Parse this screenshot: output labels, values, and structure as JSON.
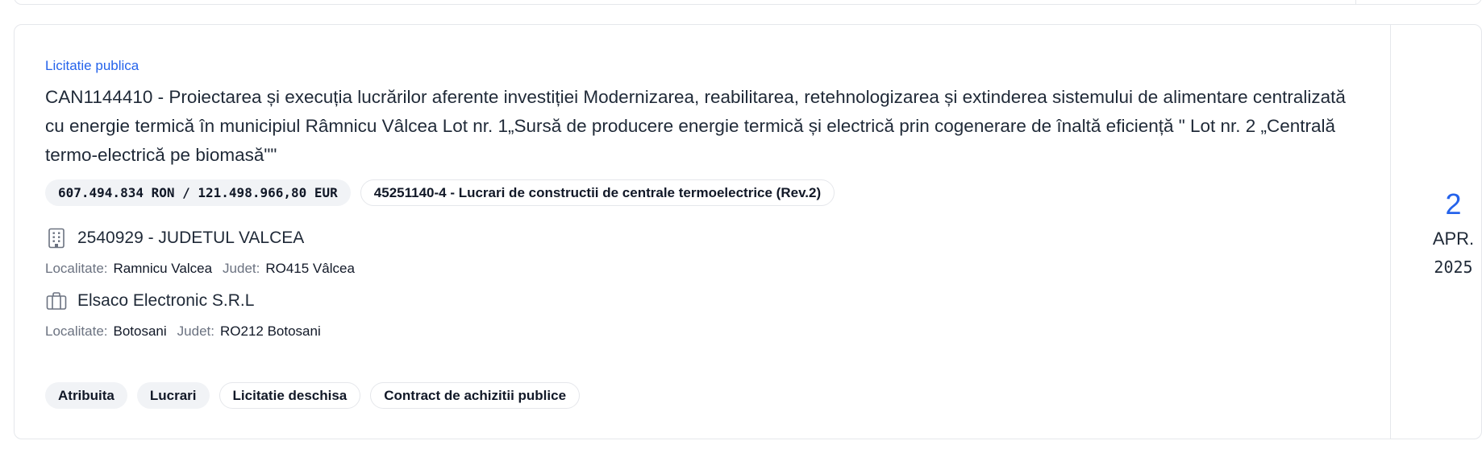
{
  "card": {
    "type_label": "Licitatie publica",
    "title": "CAN1144410 - Proiectarea și execuția lucrărilor aferente investiției Modernizarea, reabilitarea, retehnologizarea și extinderea sistemului de alimentare centralizată cu energie termică în municipiul Râmnicu Vâlcea Lot nr. 1„Sursă de producere energie termică și electrică prin cogenerare de înaltă eficiență \" Lot nr. 2 „Centrală termo-electrică pe biomasă\"\"",
    "value_pill": "607.494.834 RON / 121.498.966,80 EUR",
    "cpv_pill": "45251140-4 - Lucrari de constructii de centrale termoelectrice (Rev.2)",
    "authority": {
      "name": "2540929 - JUDETUL VALCEA",
      "localitate_label": "Localitate:",
      "localitate": "Ramnicu Valcea",
      "judet_label": "Judet:",
      "judet": "RO415 Vâlcea",
      "icon": "building-icon"
    },
    "supplier": {
      "name": "Elsaco Electronic S.R.L",
      "localitate_label": "Localitate:",
      "localitate": "Botosani",
      "judet_label": "Judet:",
      "judet": "RO212 Botosani",
      "icon": "briefcase-icon"
    },
    "tags": [
      "Atribuita",
      "Lucrari",
      "Licitatie deschisa",
      "Contract de achizitii publice"
    ],
    "date": {
      "day": "2",
      "month": "APR.",
      "year": "2025"
    }
  },
  "colors": {
    "accent": "#2563eb",
    "border": "#e5e7eb",
    "pill_bg": "#f1f3f6"
  }
}
